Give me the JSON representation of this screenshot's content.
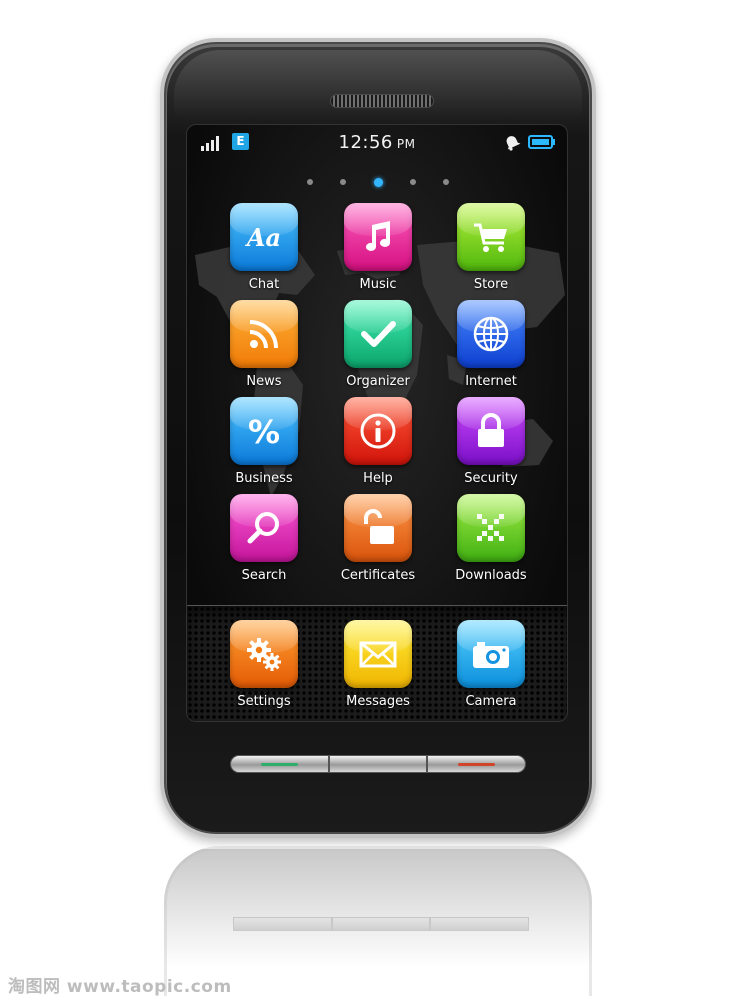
{
  "status_bar": {
    "network": "E",
    "time": "12:56",
    "ampm": "PM"
  },
  "pages": {
    "count": 5,
    "active_index": 2
  },
  "apps": [
    {
      "label": "Chat",
      "icon": "aa-text-icon",
      "color": "#1a9bf0"
    },
    {
      "label": "Music",
      "icon": "music-note-icon",
      "color": "#e8239a"
    },
    {
      "label": "Store",
      "icon": "shopping-cart-icon",
      "color": "#7ed321"
    },
    {
      "label": "News",
      "icon": "rss-feed-icon",
      "color": "#f7941d"
    },
    {
      "label": "Organizer",
      "icon": "checkmark-icon",
      "color": "#1dc98a"
    },
    {
      "label": "Internet",
      "icon": "globe-icon",
      "color": "#2a64f0"
    },
    {
      "label": "Business",
      "icon": "percent-icon",
      "color": "#1a9bf0"
    },
    {
      "label": "Help",
      "icon": "info-icon",
      "color": "#e8321e"
    },
    {
      "label": "Security",
      "icon": "lock-icon",
      "color": "#a52ee6"
    },
    {
      "label": "Search",
      "icon": "magnifier-icon",
      "color": "#e82bb8"
    },
    {
      "label": "Certificates",
      "icon": "unlock-icon",
      "color": "#f0701e"
    },
    {
      "label": "Downloads",
      "icon": "download-pattern-icon",
      "color": "#6ccb2a"
    }
  ],
  "dock": [
    {
      "label": "Settings",
      "icon": "gears-icon",
      "color": "#f37a12"
    },
    {
      "label": "Messages",
      "icon": "envelope-icon",
      "color": "#f5c400"
    },
    {
      "label": "Camera",
      "icon": "camera-icon",
      "color": "#1ba6ee"
    }
  ],
  "hardware_buttons": [
    {
      "name": "call",
      "stripe_color": "#2fae6b"
    },
    {
      "name": "menu",
      "stripe_color": ""
    },
    {
      "name": "end",
      "stripe_color": "#d0452a"
    }
  ],
  "watermark": "淘图网 www.taopic.com"
}
